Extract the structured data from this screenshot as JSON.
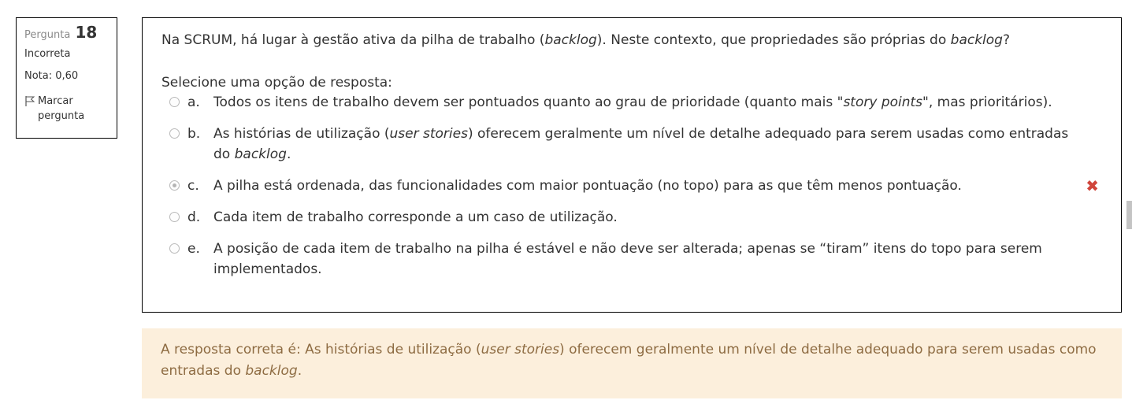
{
  "info": {
    "question_label": "Pergunta",
    "question_number": "18",
    "state": "Incorreta",
    "grade": "Nota: 0,60",
    "flag_label": "Marcar pergunta"
  },
  "question": {
    "text_before": "Na SCRUM, há lugar à gestão ativa da pilha de trabalho (",
    "text_em1": "backlog",
    "text_mid": "). Neste contexto, que propriedades são próprias do ",
    "text_em2": "backlog",
    "text_after": "?"
  },
  "prompt": "Selecione uma opção de resposta:",
  "answers": {
    "a": {
      "letter": "a.",
      "before": "Todos os itens de trabalho devem ser pontuados quanto ao grau de prioridade (quanto mais \"",
      "em": "story points",
      "after": "\", mas prioritários)."
    },
    "b": {
      "letter": "b.",
      "before": "As histórias de utilização (",
      "em": "user stories",
      "mid": ") oferecem geralmente um nível de detalhe adequado para serem usadas como entradas do ",
      "em2": "backlog",
      "after": "."
    },
    "c": {
      "letter": "c.",
      "text": "A pilha está ordenada, das funcionalidades com maior pontuação (no topo) para as que têm menos pontuação.",
      "selected": true,
      "result_icon": "incorrect-x-icon"
    },
    "d": {
      "letter": "d.",
      "text": "Cada item de trabalho corresponde a um caso de utilização."
    },
    "e": {
      "letter": "e.",
      "text": "A posição de cada item de trabalho na pilha é estável e não deve ser alterada; apenas se “tiram” itens do topo para serem implementados."
    }
  },
  "feedback": {
    "before": "A resposta correta é: As histórias de utilização (",
    "em": "user stories",
    "mid": ") oferecem geralmente um nível de detalhe adequado para serem usadas como entradas do ",
    "em2": "backlog",
    "after": "."
  },
  "colors": {
    "feedback_bg": "#fcefdc",
    "feedback_text": "#8e6c43",
    "incorrect": "#d0453b"
  }
}
